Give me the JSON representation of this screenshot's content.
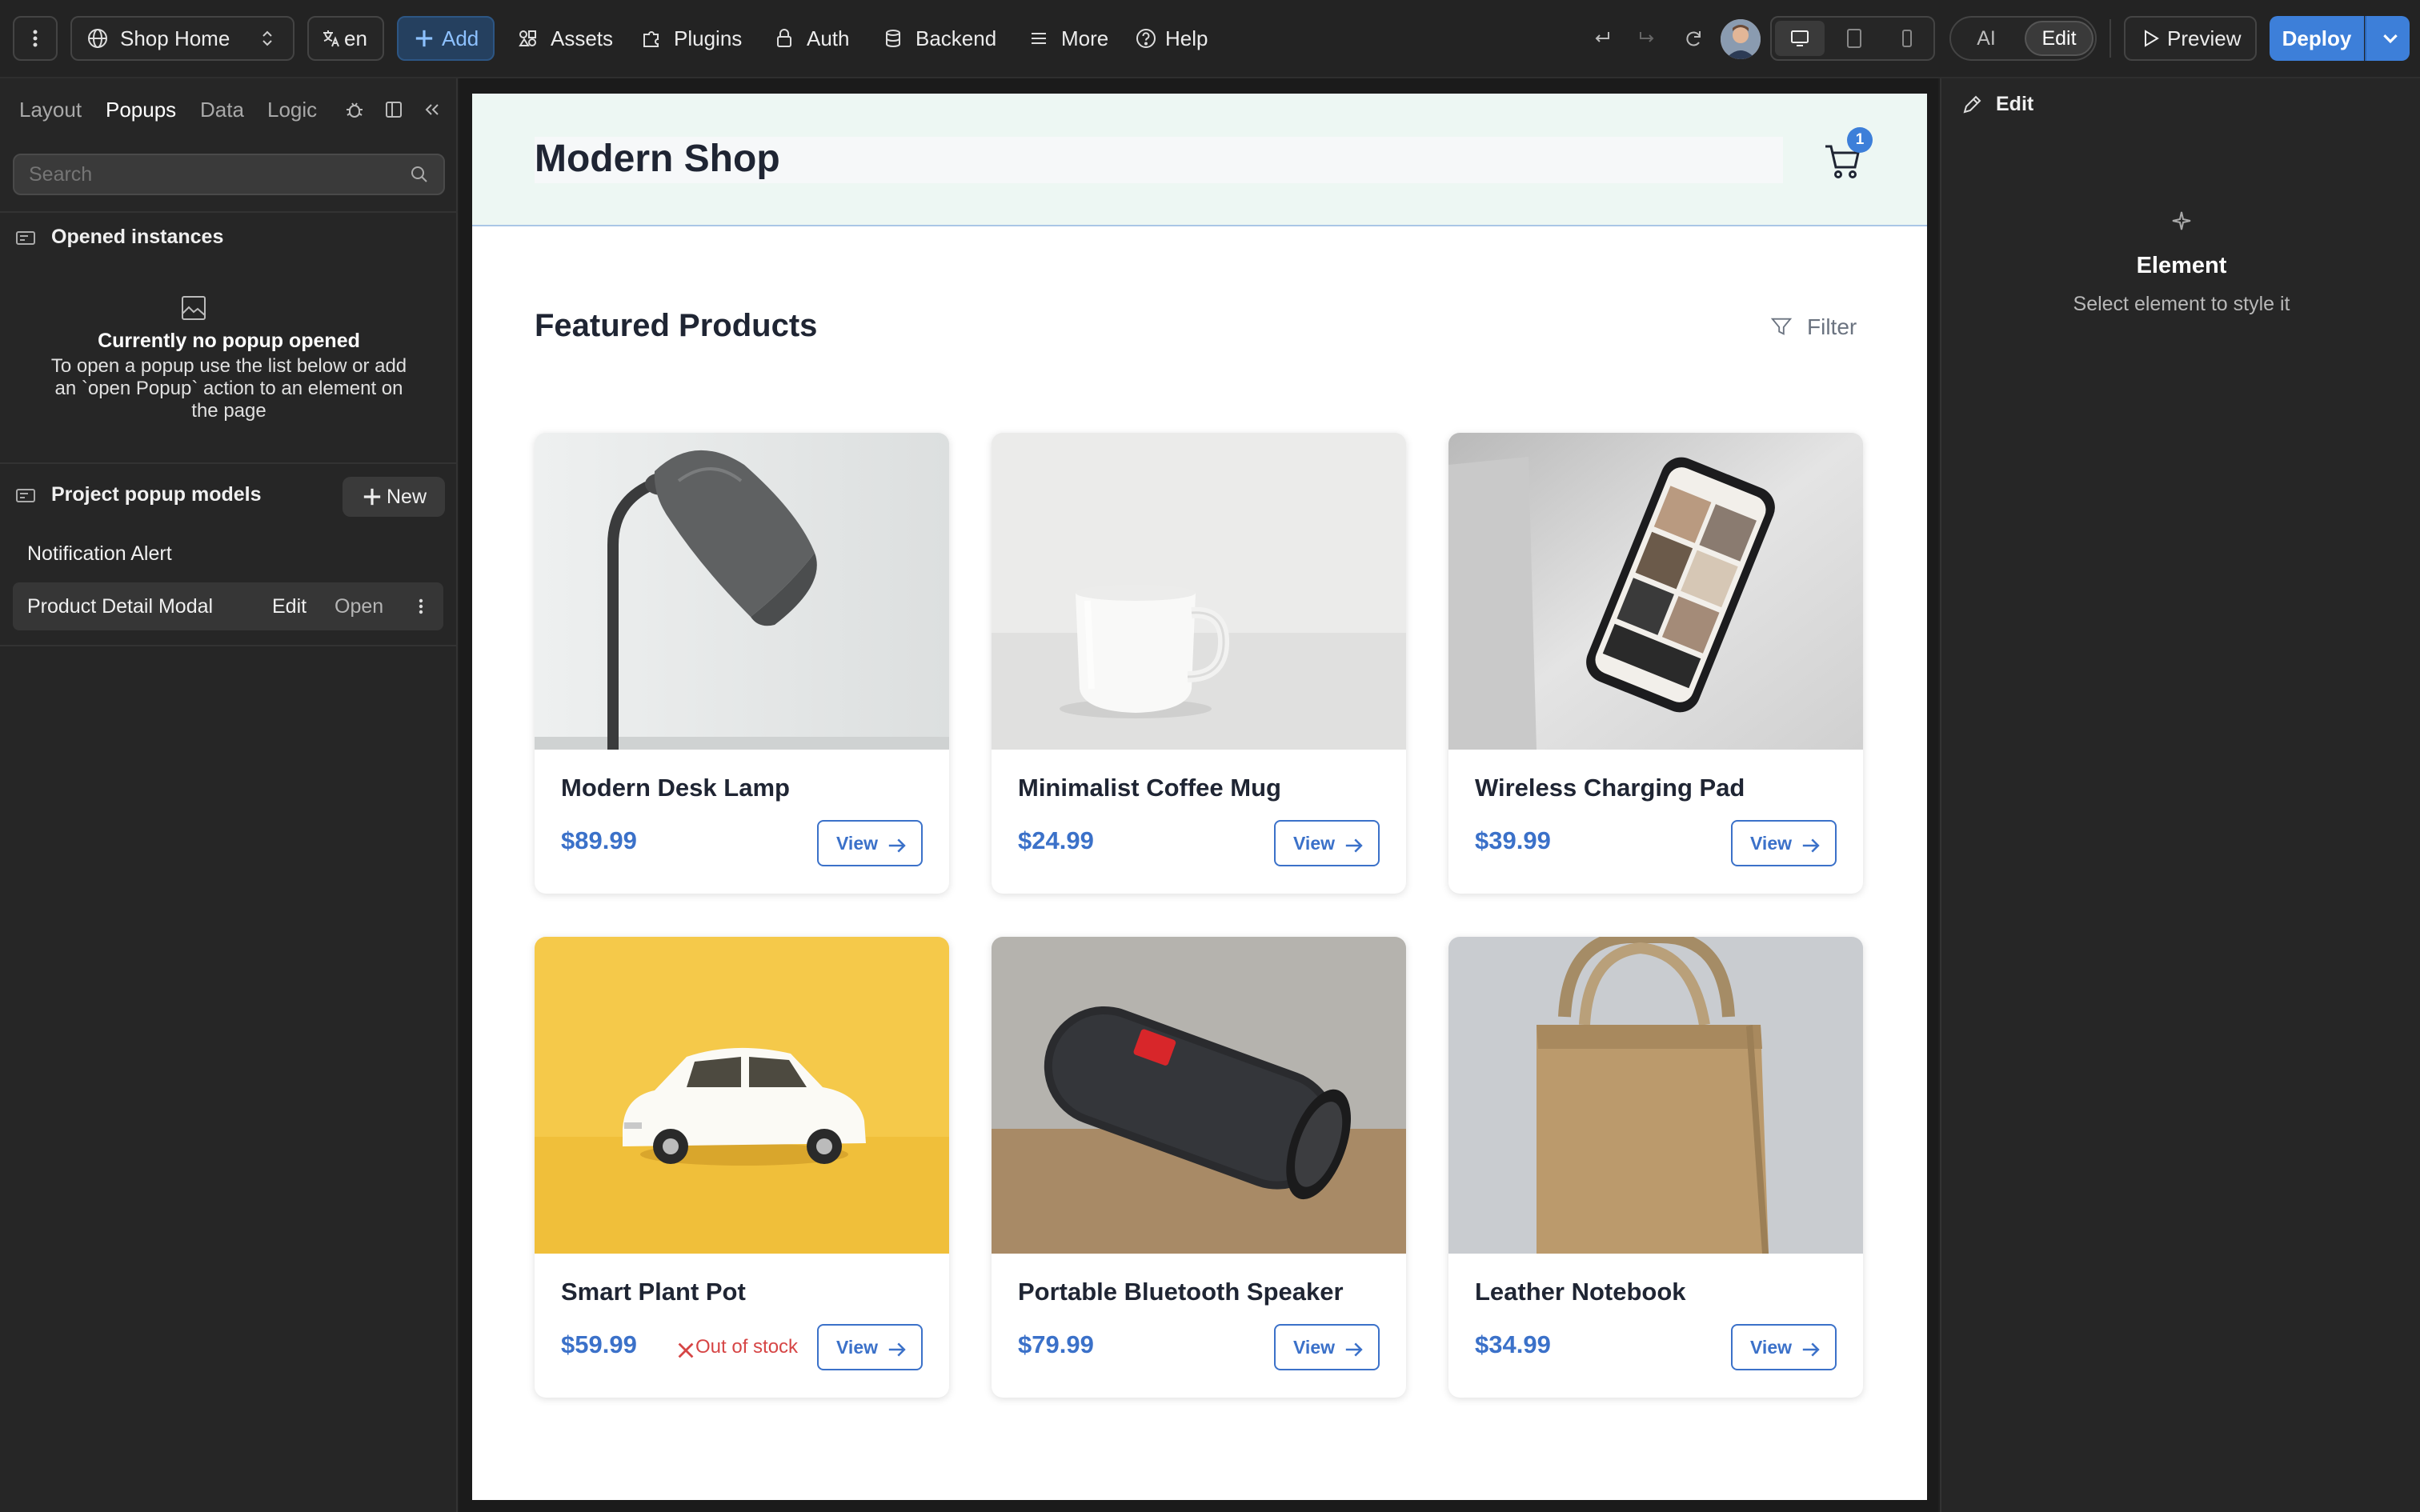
{
  "topbar": {
    "page_selector": "Shop Home",
    "language": "en",
    "add": "Add",
    "assets": "Assets",
    "plugins": "Plugins",
    "auth": "Auth",
    "backend": "Backend",
    "more": "More",
    "help": "Help",
    "mode_ai": "AI",
    "mode_edit": "Edit",
    "preview": "Preview",
    "deploy": "Deploy"
  },
  "left_panel": {
    "tabs": [
      "Layout",
      "Popups",
      "Data",
      "Logic"
    ],
    "active_tab": "Popups",
    "search_placeholder": "Search",
    "opened_instances_title": "Opened instances",
    "empty_title": "Currently no popup opened",
    "empty_desc_1": "To open a popup use the list below or add",
    "empty_desc_2": "an `open Popup` action to an element on",
    "empty_desc_3": "the page",
    "popup_models_title": "Project popup models",
    "new_button": "New",
    "popup_models": [
      {
        "name": "Notification Alert"
      },
      {
        "name": "Product Detail Modal",
        "edit": "Edit",
        "open": "Open"
      }
    ]
  },
  "shop_page": {
    "brand": "Modern Shop",
    "cart_count": "1",
    "section_title": "Featured Products",
    "filter_label": "Filter",
    "view_label": "View",
    "out_of_stock_label": "Out of stock",
    "products": [
      {
        "name": "Modern Desk Lamp",
        "price": "$89.99"
      },
      {
        "name": "Minimalist Coffee Mug",
        "price": "$24.99"
      },
      {
        "name": "Wireless Charging Pad",
        "price": "$39.99"
      },
      {
        "name": "Smart Plant Pot",
        "price": "$59.99"
      },
      {
        "name": "Portable Bluetooth Speaker",
        "price": "$79.99"
      },
      {
        "name": "Leather Notebook",
        "price": "$34.99"
      }
    ]
  },
  "right_panel": {
    "header": "Edit",
    "element_title": "Element",
    "element_hint": "Select element to style it"
  },
  "colors": {
    "accent_blue": "#3b71c9",
    "deploy_blue": "#3d7fd9",
    "out_of_stock_red": "#d64545",
    "header_bg": "#edf7f3"
  }
}
